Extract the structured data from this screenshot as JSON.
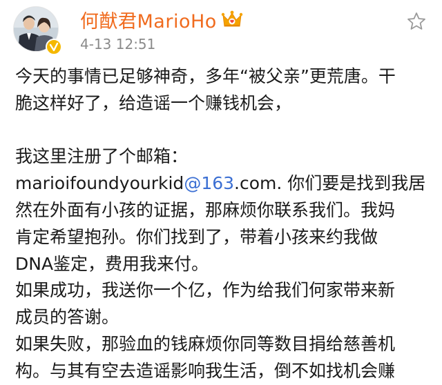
{
  "post": {
    "username": "何猷君MarioHo",
    "timestamp": "4-13 12:51",
    "icons": {
      "avatar": "profile-photo",
      "verified": "verified-badge-icon",
      "crown": "crown-icon",
      "favorite": "star-icon"
    },
    "colors": {
      "username": "#f06b1e",
      "link": "#3b6fd3",
      "verified": "#f5b800",
      "crown": "#f5a300"
    },
    "body": {
      "line1": "今天的事情已足够神奇，多年“被父亲”更荒唐。干",
      "line2": "脆这样好了，给造谣一个赚钱机会，",
      "line3": "我这里注册了个邮箱：",
      "email_user": "marioifoundyourkid",
      "email_at": "@163",
      "email_rest": ".com. 你们要是找到我居",
      "line5": "然在外面有小孩的证据，那麻烦你联系我们。我妈",
      "line6": "肯定希望抱孙。你们找到了，带着小孩来约我做",
      "line7": "DNA鉴定，费用我来付。",
      "line8": "如果成功，我送你一个亿，作为给我们何家带来新",
      "line9": "成员的答谢。",
      "line10": "如果失败，那验血的钱麻烦你同等数目捐给慈善机",
      "line11": "构。与其有空去造谣影响我生活，倒不如找机会赚"
    }
  }
}
